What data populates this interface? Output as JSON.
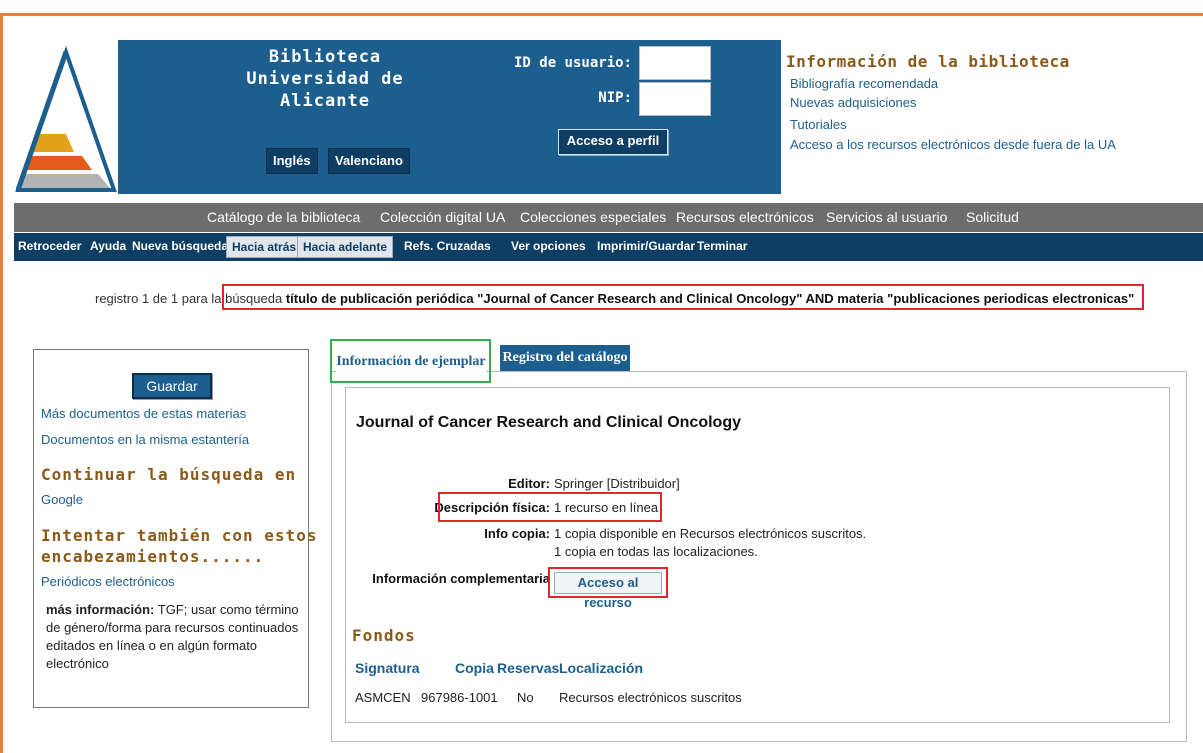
{
  "header": {
    "title_line1": "Biblioteca",
    "title_line2": "Universidad de Alicante",
    "lang_ingles": "Inglés",
    "lang_valenciano": "Valenciano",
    "user_id_label": "ID de usuario:",
    "pin_label": "NIP:",
    "user_id_value": "",
    "pin_value": "",
    "profile_button": "Acceso a perfil",
    "info_title": "Información de la biblioteca",
    "info_links": [
      "Bibliografía recomendada",
      "Nuevas adquisiciones",
      "Tutoriales",
      "Acceso a los recursos electrónicos desde fuera de la UA"
    ]
  },
  "nav_main": [
    "Catálogo de la biblioteca",
    "Colección digital UA",
    "Colecciones especiales",
    "Recursos electrónicos",
    "Servicios al usuario",
    "Solicitud"
  ],
  "nav_tools": {
    "retroceder": "Retroceder",
    "ayuda": "Ayuda",
    "nueva_busqueda": "Nueva búsqueda",
    "hacia_atras": "Hacia atrás",
    "hacia_adelante": "Hacia adelante",
    "refs": "Refs. Cruzadas",
    "ver_opciones": "Ver opciones",
    "imprimir": "Imprimir/Guardar",
    "terminar": "Terminar"
  },
  "summary": {
    "prefix": "registro 1 de 1 para la",
    "word": "búsqueda",
    "query": "título de publicación periódica \"Journal of Cancer Research and Clinical Oncology\" AND materia \"publicaciones periodicas electronicas\""
  },
  "sidebar": {
    "save_button": "Guardar",
    "link_more_docs": "Más documentos de estas materias",
    "link_same_shelf": "Documentos en la misma estantería",
    "continue_head": "Continuar la búsqueda en",
    "link_google": "Google",
    "try_head_line1": "Intentar también con estos",
    "try_head_line2": "encabezamientos......",
    "link_periodicos": "Periódicos electrónicos",
    "more_info_label": "más información:",
    "more_info_text": "TGF; usar como término de género/forma para recursos continuados editados en línea o en algún formato electrónico"
  },
  "tabs": {
    "active": "Información de ejemplar",
    "inactive": "Registro del catálogo"
  },
  "record": {
    "title": "Journal of Cancer Research and Clinical Oncology",
    "editor_label": "Editor:",
    "editor_value": "Springer [Distribuidor]",
    "desc_label": "Descripción física:",
    "desc_value": "1 recurso en línea",
    "copy_label": "Info copia:",
    "copy_value_1": "1 copia disponible en Recursos electrónicos suscritos.",
    "copy_value_2": "1 copia en todas las localizaciones.",
    "extra_label": "Información complementaria",
    "access_button": "Acceso al recurso"
  },
  "holdings": {
    "heading": "Fondos",
    "columns": [
      "Signatura",
      "Copia",
      "Reservas",
      "Localización"
    ],
    "row": [
      "ASMCEN",
      "967986-1001",
      "No",
      "Recursos electrónicos suscritos"
    ]
  },
  "colors": {
    "header_blue": "#1c5f8e",
    "nav_gray": "#6d6d6d",
    "nav_dark": "#0f3e64",
    "heading_brown": "#8a5a1a",
    "highlight_red": "#e0282b",
    "highlight_green": "#2fb04a",
    "frame_orange": "#e8823a"
  }
}
